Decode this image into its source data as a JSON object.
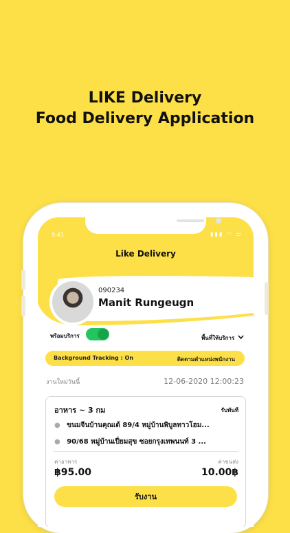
{
  "headline": {
    "line1": "LIKE Delivery",
    "line2": "Food Delivery Application"
  },
  "status_bar": {
    "time": "9:41",
    "icons": "▮▮▮ ◠ ▭"
  },
  "app": {
    "title": "Like Delivery"
  },
  "profile": {
    "id": "090234",
    "name": "Manit Rungeugn"
  },
  "service": {
    "ready_label": "พร้อมบริการ",
    "toggle_on": true,
    "area_label": "พื้นที่ให้บริการ",
    "area_chevron": "chevron-down-icon"
  },
  "tracking": {
    "status": "Background Tracking : On",
    "link": "ติดตามตำแหน่งพนักงาน"
  },
  "jobs": {
    "label": "งานใหม่วันนี้",
    "datetime": "12-06-2020  12:00:23"
  },
  "order": {
    "type": "อาหาร ~ 3 กม",
    "timing": "รับทันที",
    "pickup": "ขนมจีนบ้านคุณเด้ 89/4 หมู่บ้านพิบูลทาวโฮม...",
    "dropoff": "90/68 หมู่บ้านเปี่ยมสุข ซอยกรุงเทพนนท์ 3 ...",
    "food_cost_label": "ค่าอาหาร",
    "food_cost": "฿95.00",
    "delivery_cost_label": "ค่าขนส่ง",
    "delivery_cost": "10.00฿",
    "accept_label": "รับงาน"
  },
  "colors": {
    "background": "#fde047",
    "toggle": "#22c55e"
  }
}
